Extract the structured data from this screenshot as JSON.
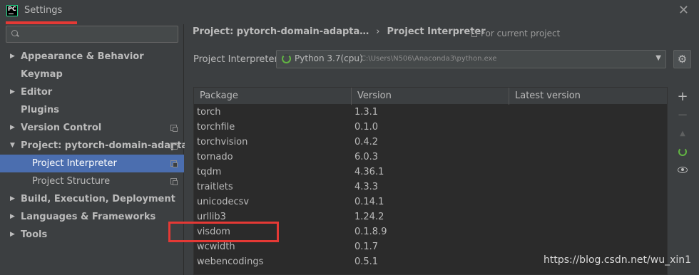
{
  "window": {
    "title": "Settings",
    "logo_text": "PC",
    "close_glyph": "✕"
  },
  "sidebar": {
    "search_placeholder": "",
    "items": [
      {
        "label": "Appearance & Behavior",
        "arrow": "▶"
      },
      {
        "label": "Keymap",
        "arrow": ""
      },
      {
        "label": "Editor",
        "arrow": "▶"
      },
      {
        "label": "Plugins",
        "arrow": ""
      },
      {
        "label": "Version Control",
        "arrow": "▶"
      },
      {
        "label": "Project: pytorch-domain-adapta…",
        "arrow": "▼"
      },
      {
        "label": "Project Interpreter",
        "arrow": ""
      },
      {
        "label": "Project Structure",
        "arrow": ""
      },
      {
        "label": "Build, Execution, Deployment",
        "arrow": "▶"
      },
      {
        "label": "Languages & Frameworks",
        "arrow": "▶"
      },
      {
        "label": "Tools",
        "arrow": "▶"
      }
    ]
  },
  "main": {
    "breadcrumb_project": "Project: pytorch-domain-adapta…",
    "breadcrumb_sep": "›",
    "breadcrumb_page": "Project Interpreter",
    "for_current_project": "For current project",
    "interpreter_label": "Project Interpreter:",
    "interpreter_name": "Python 3.7(cpu)",
    "interpreter_path": "C:\\Users\\N506\\Anaconda3\\python.exe",
    "dropdown_glyph": "▼",
    "gear_glyph": "⚙"
  },
  "table": {
    "headers": [
      "Package",
      "Version",
      "Latest version"
    ],
    "rows": [
      [
        "torch",
        "1.3.1",
        ""
      ],
      [
        "torchfile",
        "0.1.0",
        ""
      ],
      [
        "torchvision",
        "0.4.2",
        ""
      ],
      [
        "tornado",
        "6.0.3",
        ""
      ],
      [
        "tqdm",
        "4.36.1",
        ""
      ],
      [
        "traitlets",
        "4.3.3",
        ""
      ],
      [
        "unicodecsv",
        "0.14.1",
        ""
      ],
      [
        "urllib3",
        "1.24.2",
        ""
      ],
      [
        "visdom",
        "0.1.8.9",
        ""
      ],
      [
        "wcwidth",
        "0.1.7",
        ""
      ],
      [
        "webencodings",
        "0.5.1",
        ""
      ]
    ]
  },
  "toolbar": {
    "add_glyph": "+",
    "remove_glyph": "−",
    "upgrade_glyph": "▲"
  },
  "watermark": "https://blog.csdn.net/wu_xin1",
  "colors": {
    "accent_selection": "#4b6eaf",
    "highlight_red": "#e53935",
    "loading_green": "#62b543"
  }
}
